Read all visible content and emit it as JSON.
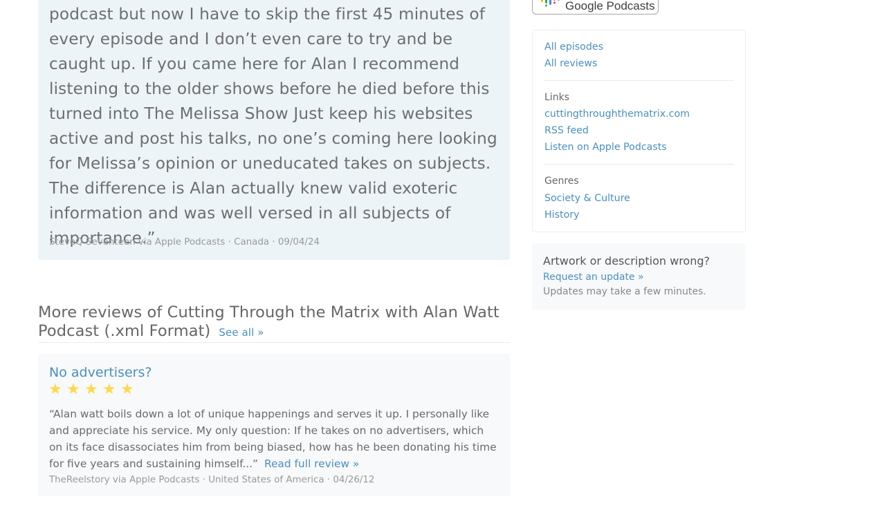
{
  "featured_review": {
    "text": "podcast but now I have to skip the first 45 minutes of every episode and I don’t even care to try and be caught up. If you came here for Alan I recommend listening to the older shows before he died before this turned into The Melissa Show Just keep his websites active and post his talks, no one’s coming here looking for Melissa’s opinion or uneducated takes on subjects. The difference is Alan actually knew valid exoteric information and was well versed in all subjects of importance.”",
    "meta": "SteveQ Seventeen via Apple Podcasts · Canada · 09/04/24"
  },
  "more_reviews": {
    "heading": "More reviews of Cutting Through the Matrix with Alan Watt Podcast (.xml Format)",
    "see_all": "See all »",
    "reviews": [
      {
        "title": "No advertisers?",
        "rating": 5,
        "star_glyph": "★",
        "text": "“Alan watt boils down a lot of unique happenings and serves it up. I personally like and appreciate his service. My only question: If he takes on no advertisers, which on its face disassociates him from being biased, how has he been donating his time for five years and sustaining himself...”",
        "read_full": "Read full review »",
        "meta": "TheReelstory via Apple Podcasts · United States of America · 04/26/12"
      }
    ]
  },
  "sidebar": {
    "badge": {
      "label": "Google Podcasts",
      "icon": "google-podcasts-icon"
    },
    "nav": {
      "all_episodes": "All episodes",
      "all_reviews": "All reviews"
    },
    "links": {
      "label": "Links",
      "items": [
        "cuttingthroughthematrix.com",
        "RSS feed",
        "Listen on Apple Podcasts"
      ]
    },
    "genres": {
      "label": "Genres",
      "items": [
        "Society & Culture",
        "History"
      ]
    },
    "update_box": {
      "title": "Artwork or description wrong?",
      "link": "Request an update »",
      "note": "Updates may take a few minutes."
    }
  },
  "colors": {
    "link": "#4a8fc0",
    "featured_bg": "#edf4f8",
    "card_bg": "#f8f9fa",
    "star": "#ffd84f"
  }
}
